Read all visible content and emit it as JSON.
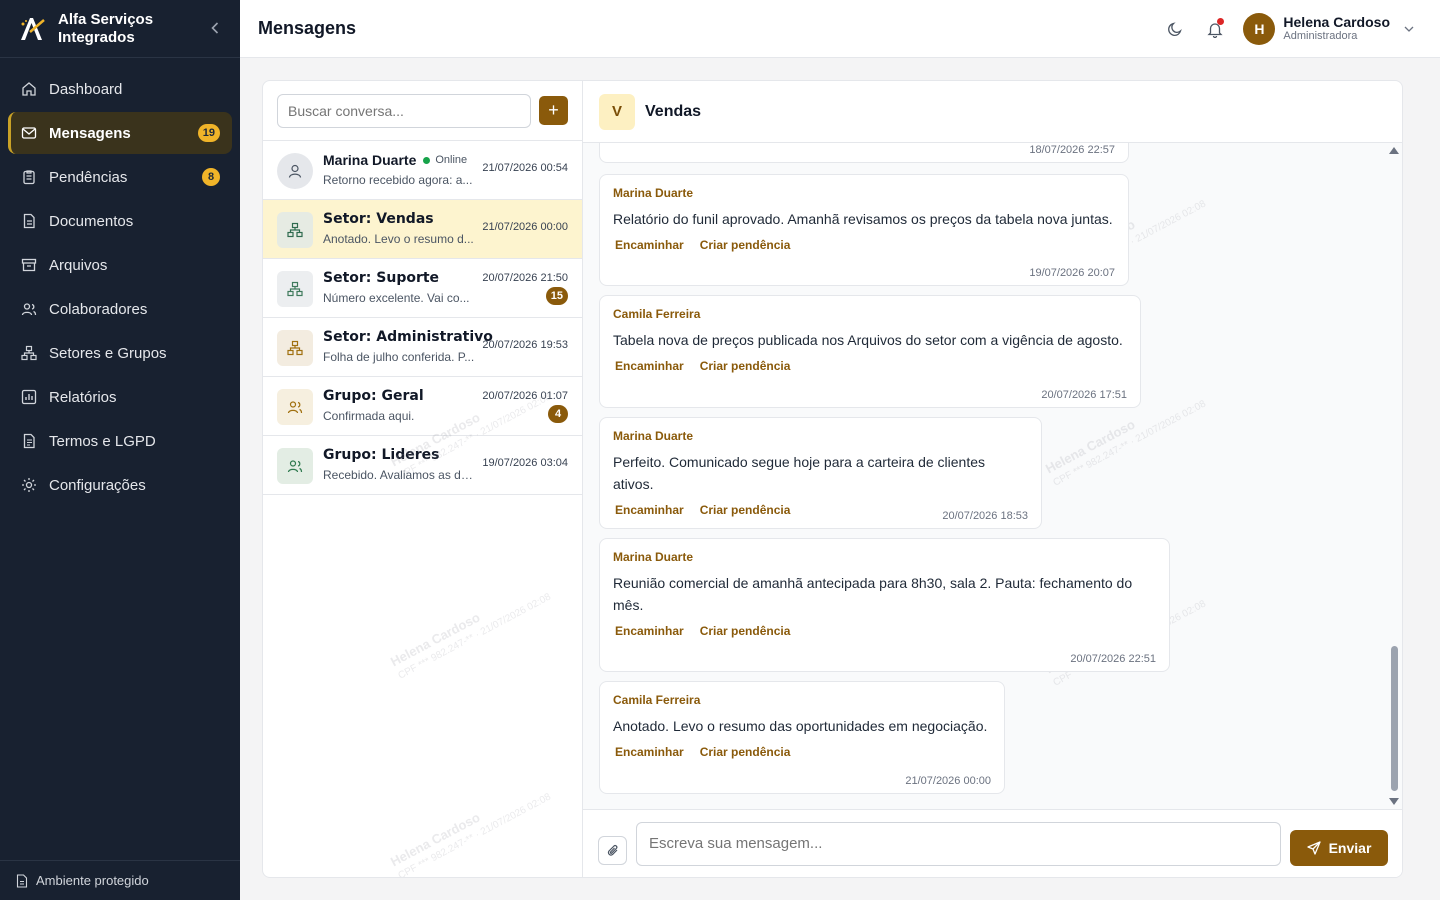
{
  "brand": {
    "name": "Alfa Serviços Integrados"
  },
  "sidebar": {
    "items": [
      {
        "label": "Dashboard",
        "icon": "home-icon"
      },
      {
        "label": "Mensagens",
        "icon": "mail-icon",
        "badge": "19",
        "active": true
      },
      {
        "label": "Pendências",
        "icon": "clipboard-icon",
        "badge": "8"
      },
      {
        "label": "Documentos",
        "icon": "document-icon"
      },
      {
        "label": "Arquivos",
        "icon": "archive-icon"
      },
      {
        "label": "Colaboradores",
        "icon": "users-icon"
      },
      {
        "label": "Setores e Grupos",
        "icon": "org-icon"
      },
      {
        "label": "Relatórios",
        "icon": "chart-icon"
      },
      {
        "label": "Termos e LGPD",
        "icon": "terms-icon"
      },
      {
        "label": "Configurações",
        "icon": "gear-icon"
      }
    ],
    "footer": "Ambiente protegido"
  },
  "header": {
    "title": "Mensagens",
    "user": {
      "initial": "H",
      "name": "Helena Cardoso",
      "role": "Administradora"
    }
  },
  "conversations": {
    "search_placeholder": "Buscar conversa...",
    "add_label": "+",
    "items": [
      {
        "name": "Marina Duarte",
        "status": "Online",
        "preview": "Retorno recebido agora: a...",
        "time": "21/07/2026 00:54"
      },
      {
        "name": "Setor: Vendas",
        "preview": "Anotado. Levo o resumo d...",
        "time": "21/07/2026 00:00"
      },
      {
        "name": "Setor: Suporte",
        "preview": "Número excelente. Vai co...",
        "time": "20/07/2026 21:50",
        "badge": "15"
      },
      {
        "name": "Setor: Administrativo",
        "preview": "Folha de julho conferida. P...",
        "time": "20/07/2026 19:53"
      },
      {
        "name": "Grupo: Geral",
        "preview": "Confirmada aqui.",
        "time": "20/07/2026 01:07",
        "badge": "4"
      },
      {
        "name": "Grupo: Lideres",
        "preview": "Recebido. Avaliamos as du...",
        "time": "19/07/2026 03:04"
      }
    ]
  },
  "chat": {
    "avatar": "V",
    "title": "Vendas",
    "actions": {
      "forward": "Encaminhar",
      "create_task": "Criar pendência"
    },
    "top_partial_time": "18/07/2026 22:57",
    "messages": [
      {
        "author": "Marina Duarte",
        "text": "Relatório do funil aprovado. Amanhã revisamos os preços da tabela nova juntas.",
        "time": "19/07/2026 20:07"
      },
      {
        "author": "Camila Ferreira",
        "text": "Tabela nova de preços publicada nos Arquivos do setor com a vigência de agosto.",
        "time": "20/07/2026 17:51"
      },
      {
        "author": "Marina Duarte",
        "text": "Perfeito. Comunicado segue hoje para a carteira de clientes ativos.",
        "time": "20/07/2026 18:53"
      },
      {
        "author": "Marina Duarte",
        "text": "Reunião comercial de amanhã antecipada para 8h30, sala 2. Pauta: fechamento do mês.",
        "time": "20/07/2026 22:51"
      },
      {
        "author": "Camila Ferreira",
        "text": "Anotado. Levo o resumo das oportunidades em negociação.",
        "time": "21/07/2026 00:00"
      }
    ],
    "composer_placeholder": "Escreva sua mensagem...",
    "send_label": "Enviar"
  },
  "watermark": {
    "line1": "Helena Cardoso",
    "line2": "CPF *** 982.247-** · 21/07/2026 02:08"
  },
  "colors": {
    "sidebar": "#182130",
    "accent": "#8a5a0b",
    "badge": "#f0b429",
    "active_conv": "#fdf4cf"
  }
}
